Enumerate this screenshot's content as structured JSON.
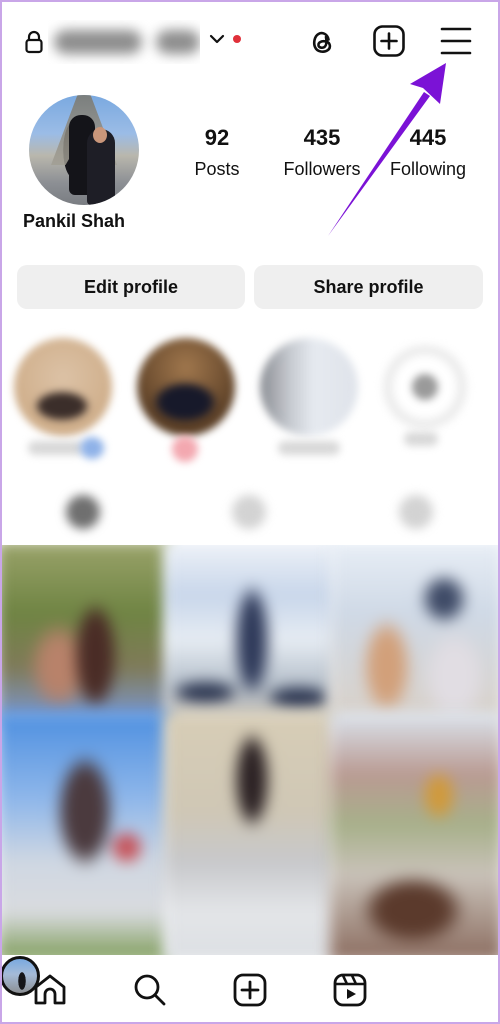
{
  "header": {
    "username": "[redacted]",
    "username_blurred": true,
    "lock_icon": "lock-icon",
    "account_switcher_icon": "chevron-down-icon",
    "notification_dot_color": "#e0303a",
    "actions": [
      {
        "name": "threads",
        "icon": "threads-icon"
      },
      {
        "name": "create",
        "icon": "plus-square-icon"
      },
      {
        "name": "menu",
        "icon": "hamburger-menu-icon"
      }
    ]
  },
  "profile": {
    "display_name": "Pankil Shah",
    "stats": [
      {
        "value": "92",
        "label": "Posts"
      },
      {
        "value": "435",
        "label": "Followers"
      },
      {
        "value": "445",
        "label": "Following"
      }
    ]
  },
  "buttons": {
    "edit_profile": "Edit profile",
    "share_profile": "Share profile"
  },
  "highlights": {
    "count_visible": 4,
    "blurred": true
  },
  "tabs": {
    "count": 3,
    "blurred": true
  },
  "grid": {
    "posts_visible": 6,
    "blurred": true
  },
  "bottom_nav": [
    {
      "name": "home",
      "icon": "home-icon"
    },
    {
      "name": "search",
      "icon": "search-icon"
    },
    {
      "name": "create",
      "icon": "plus-square-icon"
    },
    {
      "name": "reels",
      "icon": "reels-icon"
    },
    {
      "name": "profile",
      "icon": "profile-avatar"
    }
  ],
  "annotation": {
    "type": "arrow",
    "color": "#7b12d6",
    "points_to": "hamburger-menu-icon"
  }
}
